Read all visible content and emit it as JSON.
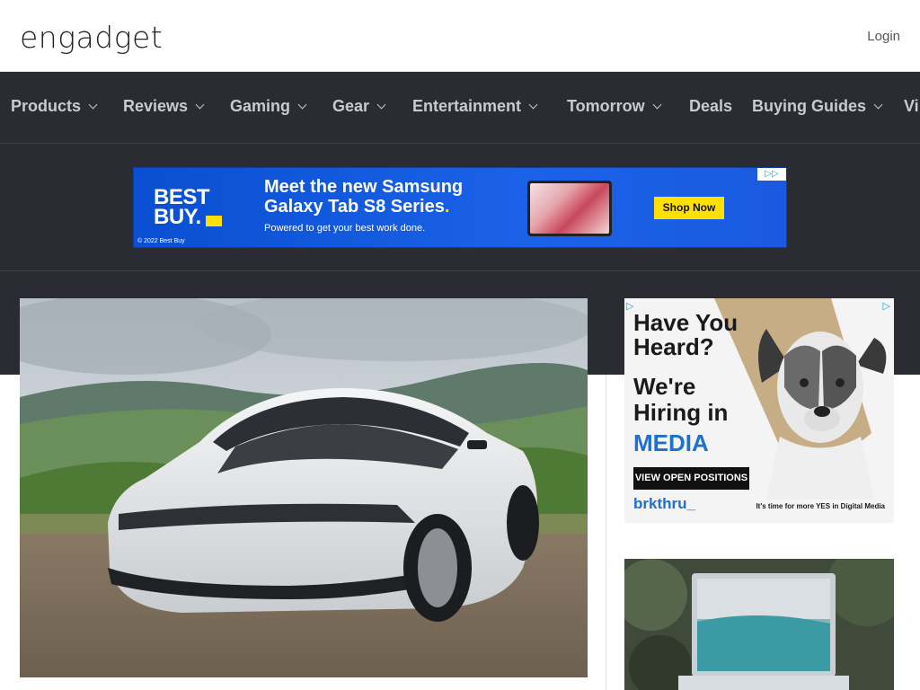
{
  "header": {
    "logo_text": "engadget",
    "login_label": "Login"
  },
  "nav": {
    "items": [
      {
        "label": "Products",
        "dropdown": true
      },
      {
        "label": "Reviews",
        "dropdown": true
      },
      {
        "label": "Gaming",
        "dropdown": true
      },
      {
        "label": "Gear",
        "dropdown": true
      },
      {
        "label": "Entertainment",
        "dropdown": true
      },
      {
        "label": "Tomorrow",
        "dropdown": true
      },
      {
        "label": "Deals",
        "dropdown": false
      },
      {
        "label": "Buying Guides",
        "dropdown": true
      },
      {
        "label": "Vi",
        "dropdown": false
      }
    ]
  },
  "banner_ad": {
    "brand_line1": "BEST",
    "brand_line2": "BUY.",
    "headline_line1": "Meet the new Samsung",
    "headline_line2": "Galaxy Tab S8 Series",
    "headline_dot": ".",
    "subline": "Powered to get your best work done.",
    "copyright": "© 2022 Best Buy",
    "cta": "Shop Now",
    "adchoices_icon": "adchoices-icon",
    "colors": {
      "background": "#1b62e8",
      "accent": "#ffe000"
    }
  },
  "hero": {
    "image_subject": "white electric sedan parked on gravel with green hills"
  },
  "side_ad": {
    "headline1": "Have You Heard?",
    "headline2": "We're Hiring in",
    "headline3": "MEDIA",
    "cta": "VIEW OPEN POSITIONS",
    "brand": "brkthru_",
    "tagline": "It's time for more YES in Digital Media",
    "colors": {
      "accent": "#1f6fcf",
      "beige": "#c7ad86"
    }
  },
  "side_thumb": {
    "image_subject": "laptop on outdoor table"
  }
}
